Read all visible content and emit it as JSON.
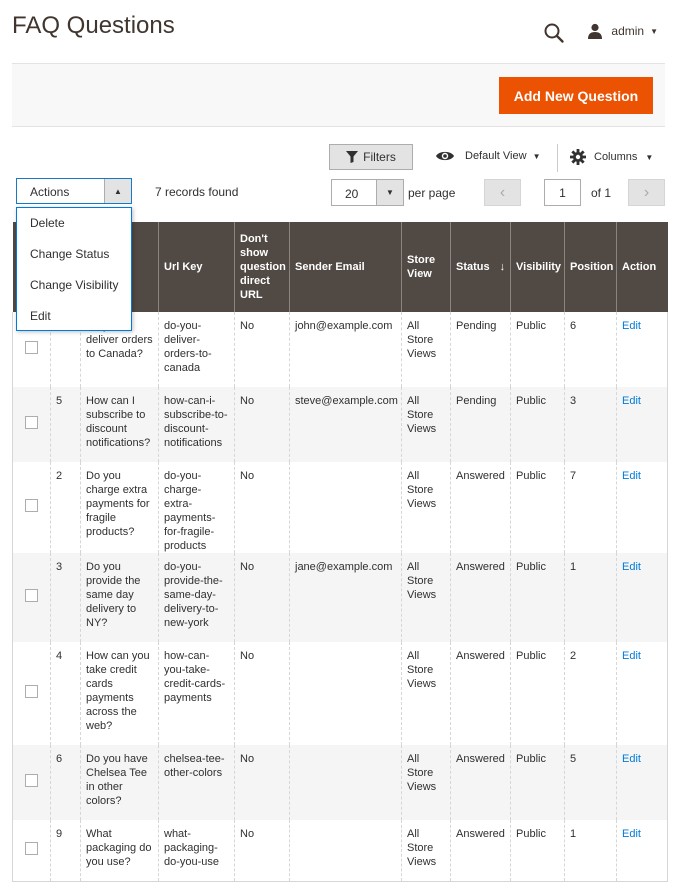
{
  "header": {
    "title": "FAQ Questions",
    "user": "admin"
  },
  "page_actions": {
    "add_label": "Add New Question"
  },
  "toolbar": {
    "filters_label": "Filters",
    "view_label": "Default View",
    "columns_label": "Columns",
    "actions_label": "Actions",
    "records_found": "7 records found",
    "per_page_value": "20",
    "per_page_label": "per page",
    "current_page": "1",
    "of_pages": "of 1"
  },
  "actions_menu": {
    "items": [
      {
        "label": "Delete"
      },
      {
        "label": "Change Status"
      },
      {
        "label": "Change Visibility"
      },
      {
        "label": "Edit"
      }
    ]
  },
  "grid": {
    "columns": [
      {
        "label": ""
      },
      {
        "label": ""
      },
      {
        "label": ""
      },
      {
        "label": "Url Key"
      },
      {
        "label": "Don't show question direct URL"
      },
      {
        "label": "Sender Email"
      },
      {
        "label": "Store View"
      },
      {
        "label": "Status"
      },
      {
        "label": "Visibility"
      },
      {
        "label": "Position"
      },
      {
        "label": "Action"
      }
    ],
    "rows": [
      {
        "id": "",
        "question": "Do you deliver orders to Canada?",
        "url_key": "do-you-deliver-orders-to-canada",
        "dont_show": "No",
        "email": "john@example.com",
        "store_view": "All Store Views",
        "status": "Pending",
        "visibility": "Public",
        "position": "6",
        "action": "Edit"
      },
      {
        "id": "5",
        "question": "How can I subscribe to discount notifications?",
        "url_key": "how-can-i-subscribe-to-discount-notifications",
        "dont_show": "No",
        "email": "steve@example.com",
        "store_view": "All Store Views",
        "status": "Pending",
        "visibility": "Public",
        "position": "3",
        "action": "Edit"
      },
      {
        "id": "2",
        "question": "Do you charge extra payments for fragile products?",
        "url_key": "do-you-charge-extra-payments-for-fragile-products",
        "dont_show": "No",
        "email": "",
        "store_view": "All Store Views",
        "status": "Answered",
        "visibility": "Public",
        "position": "7",
        "action": "Edit"
      },
      {
        "id": "3",
        "question": "Do you provide the same day delivery to NY?",
        "url_key": "do-you-provide-the-same-day-delivery-to-new-york",
        "dont_show": "No",
        "email": "jane@example.com",
        "store_view": "All Store Views",
        "status": "Answered",
        "visibility": "Public",
        "position": "1",
        "action": "Edit"
      },
      {
        "id": "4",
        "question": "How can you take credit cards payments across the web?",
        "url_key": "how-can-you-take-credit-cards-payments",
        "dont_show": "No",
        "email": "",
        "store_view": "All Store Views",
        "status": "Answered",
        "visibility": "Public",
        "position": "2",
        "action": "Edit"
      },
      {
        "id": "6",
        "question": "Do you have Chelsea Tee in other colors?",
        "url_key": "chelsea-tee-other-colors",
        "dont_show": "No",
        "email": "",
        "store_view": "All Store Views",
        "status": "Answered",
        "visibility": "Public",
        "position": "5",
        "action": "Edit"
      },
      {
        "id": "9",
        "question": "What packaging do you use?",
        "url_key": "what-packaging-do-you-use",
        "dont_show": "No",
        "email": "",
        "store_view": "All Store Views",
        "status": "Answered",
        "visibility": "Public",
        "position": "1",
        "action": "Edit"
      }
    ]
  },
  "colors": {
    "accent": "#eb5202",
    "header_bg": "#514943",
    "link": "#007bdb"
  }
}
